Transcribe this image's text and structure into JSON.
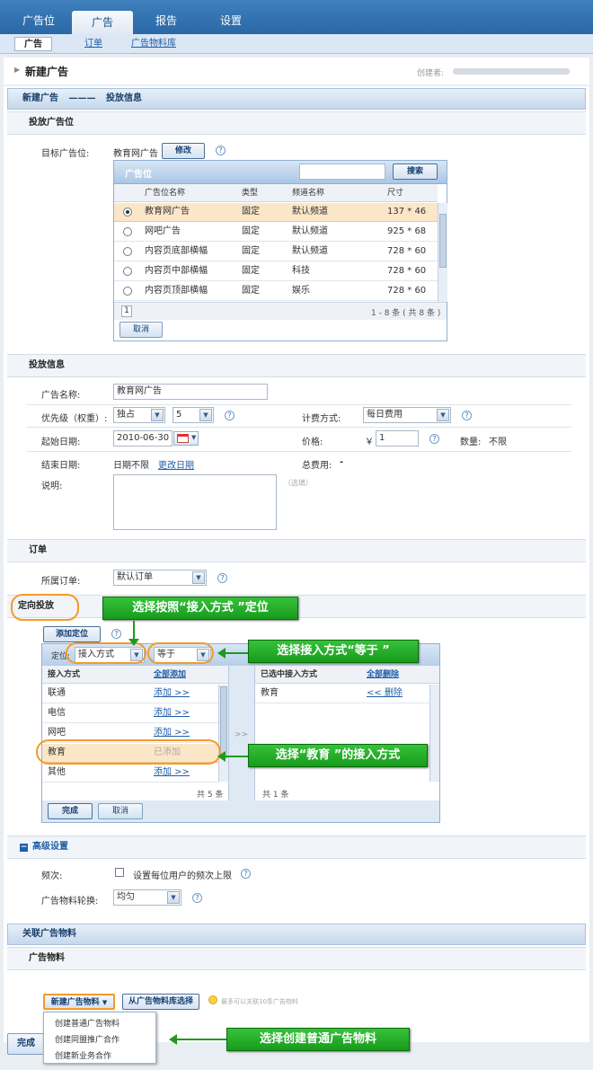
{
  "nav": {
    "tabs": [
      {
        "label": "广告位",
        "active": false
      },
      {
        "label": "广告",
        "active": true
      },
      {
        "label": "报告",
        "active": false
      },
      {
        "label": "设置",
        "active": false
      }
    ],
    "subtabs": [
      {
        "label": "广告",
        "active": true
      },
      {
        "label": "订单",
        "active": false
      },
      {
        "label": "广告物料库",
        "active": false
      }
    ]
  },
  "page": {
    "title": "新建广告",
    "creator_label": "创建者:"
  },
  "breadcrumb": {
    "step": "新建广告",
    "sep": "———",
    "current": "投放信息"
  },
  "placement": {
    "section_title": "投放广告位",
    "target_label": "目标广告位:",
    "target_value": "教育网广告",
    "modify_btn": "修改",
    "grid_title": "广告位",
    "search_btn": "搜索",
    "search_value": "",
    "columns": [
      "广告位名称",
      "类型",
      "频道名称",
      "尺寸"
    ],
    "rows": [
      {
        "name": "教育网广告",
        "type": "固定",
        "channel": "默认频道",
        "size": "137 * 46",
        "selected": true
      },
      {
        "name": "网吧广告",
        "type": "固定",
        "channel": "默认频道",
        "size": "925 * 68",
        "selected": false
      },
      {
        "name": "内容页底部横幅",
        "type": "固定",
        "channel": "默认频道",
        "size": "728 * 60",
        "selected": false
      },
      {
        "name": "内容页中部横幅",
        "type": "固定",
        "channel": "科技",
        "size": "728 * 60",
        "selected": false
      },
      {
        "name": "内容页顶部横幅",
        "type": "固定",
        "channel": "娱乐",
        "size": "728 * 60",
        "selected": false
      }
    ],
    "page_num": "1",
    "paging_info": "1 - 8 条 ( 共 8 条 )",
    "cancel_btn": "取消"
  },
  "info": {
    "section_title": "投放信息",
    "name_label": "广告名称:",
    "name_value": "教育网广告",
    "priority_label": "优先级（权重）:",
    "priority_value": "独占",
    "weight_value": "5",
    "billing_label": "计费方式:",
    "billing_value": "每日费用",
    "start_label": "起始日期:",
    "start_value": "2010-06-30",
    "price_label": "价格:",
    "price_currency": "￥",
    "price_value": "1",
    "qty_label": "数量:",
    "qty_value": "不限",
    "end_label": "结束日期:",
    "end_value": "日期不限",
    "change_date": "更改日期",
    "total_label": "总费用:",
    "total_value": "-",
    "desc_label": "说明:",
    "desc_optional": "（选填）"
  },
  "order": {
    "section_title": "订单",
    "label": "所属订单:",
    "value": "默认订单"
  },
  "targeting": {
    "section_title": "定向投放",
    "add_btn": "添加定位",
    "locate_label": "定位:",
    "method_value": "接入方式",
    "operator_value": "等于",
    "left_header": "接入方式",
    "add_all": "全部添加",
    "items": [
      {
        "name": "联通",
        "action": "添加 >>",
        "added": false
      },
      {
        "name": "电信",
        "action": "添加 >>",
        "added": false
      },
      {
        "name": "网吧",
        "action": "添加 >>",
        "added": false
      },
      {
        "name": "教育",
        "action": "已添加",
        "added": true
      },
      {
        "name": "其他",
        "action": "添加 >>",
        "added": false
      }
    ],
    "left_count": "共 5 条",
    "mid_arrow": ">>",
    "right_header": "已选中接入方式",
    "remove_all": "全部删除",
    "selected": [
      {
        "name": "教育",
        "action": "<< 删除"
      }
    ],
    "right_count": "共 1 条",
    "done_btn": "完成",
    "cancel_btn": "取消"
  },
  "advanced": {
    "section_title": "高级设置",
    "freq_label": "频次:",
    "freq_check": "设置每位用户的频次上限",
    "rotation_label": "广告物料轮换:",
    "rotation_value": "均匀"
  },
  "creative": {
    "bar_title": "关联广告物料",
    "section_title": "广告物料",
    "new_btn": "新建广告物料",
    "lib_btn": "从广告物料库选择",
    "hint": "最多可以关联10条广告物料",
    "menu": [
      "创建普通广告物料",
      "创建同盟推广合作",
      "创建新业务合作"
    ],
    "bottom_btn": "完成"
  },
  "annotations": {
    "a1": "选择按照“接入方式 ”定位",
    "a2": "选择接入方式“等于 ”",
    "a3": "选择“教育 ”的接入方式",
    "a4": "选择创建普通广告物料"
  },
  "colors": {
    "accent": "#2a67a6",
    "highlight_row": "#fce6c8",
    "annotation_green": "#1f9a1f",
    "oval_orange": "#f39a2a"
  }
}
